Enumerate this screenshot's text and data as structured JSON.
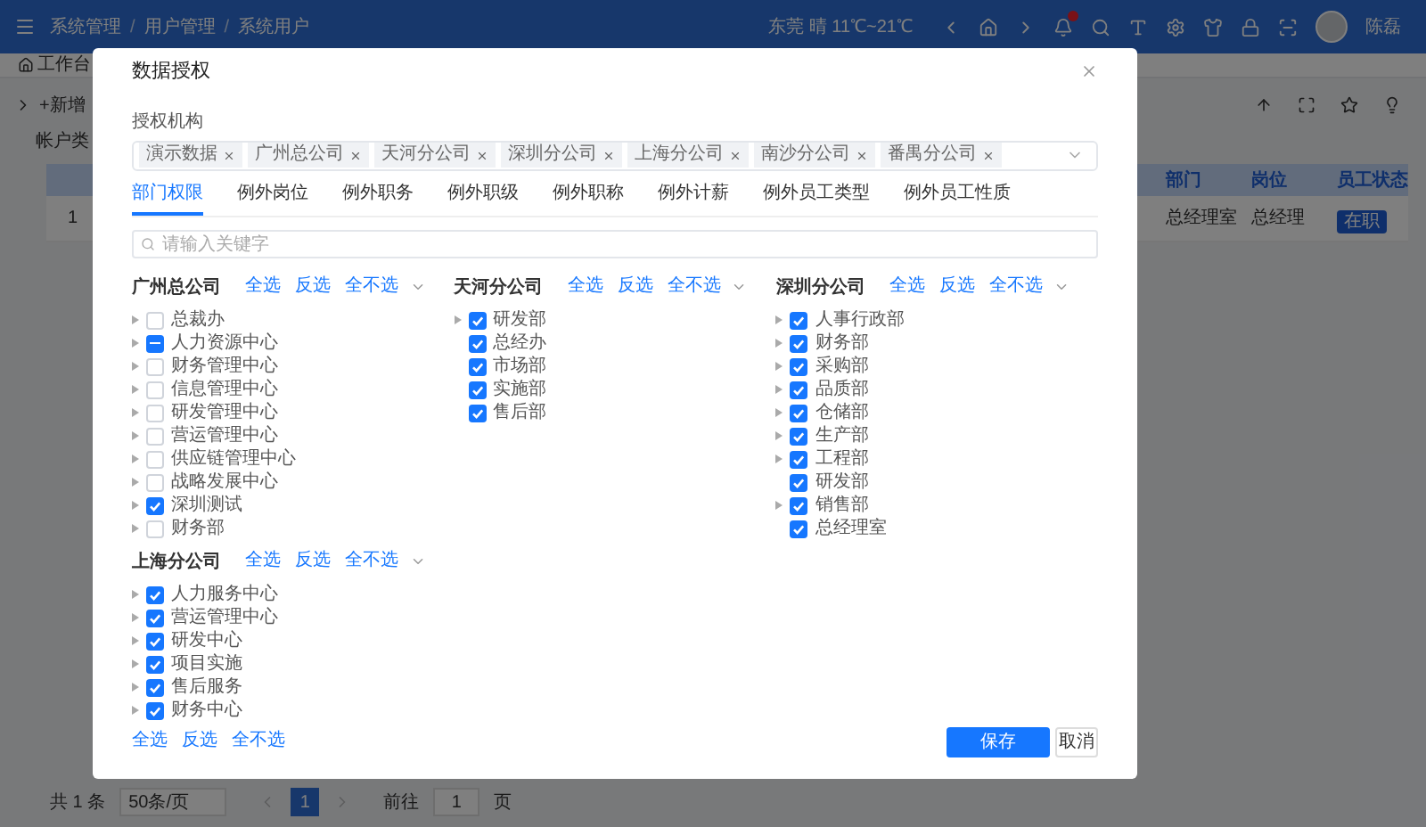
{
  "topbar": {
    "breadcrumb": [
      "系统管理",
      "用户管理",
      "系统用户"
    ],
    "separator": "/",
    "weather": "东莞 晴 11℃~21℃",
    "user": "陈磊"
  },
  "tabs_bar": {
    "tabs": [
      {
        "label": "工作台",
        "selected": true
      }
    ]
  },
  "page": {
    "add_button": "+新增",
    "filter_label": "帐户类",
    "table": {
      "columns": [
        "部门",
        "岗位",
        "员工状态"
      ],
      "rows": [
        {
          "index": "1",
          "cells": [
            "总经理室",
            "总经理"
          ],
          "status": "在职"
        }
      ]
    },
    "pagination": {
      "total": "共 1 条",
      "page_size": "50条/页",
      "pages": [
        {
          "label": "1",
          "selected": true
        }
      ],
      "goto_label": "前往",
      "goto_value": "1",
      "goto_suffix": "页"
    }
  },
  "dialog": {
    "title": "数据授权",
    "org_label": "授权机构",
    "org_tags": [
      "演示数据",
      "广州总公司",
      "天河分公司",
      "深圳分公司",
      "上海分公司",
      "南沙分公司",
      "番禺分公司"
    ],
    "tabs": [
      {
        "label": "部门权限",
        "selected": true
      },
      {
        "label": "例外岗位",
        "selected": false
      },
      {
        "label": "例外职务",
        "selected": false
      },
      {
        "label": "例外职级",
        "selected": false
      },
      {
        "label": "例外职称",
        "selected": false
      },
      {
        "label": "例外计薪",
        "selected": false
      },
      {
        "label": "例外员工类型",
        "selected": false
      },
      {
        "label": "例外员工性质",
        "selected": false
      }
    ],
    "search": {
      "placeholder": "请输入关键字"
    },
    "groups": [
      {
        "name": "广州总公司",
        "actions": [
          "全选",
          "反选",
          "全不选"
        ],
        "items": [
          {
            "label": "总裁办",
            "checked": false,
            "indeterminate": false,
            "has_children": true
          },
          {
            "label": "人力资源中心",
            "checked": false,
            "indeterminate": true,
            "has_children": true
          },
          {
            "label": "财务管理中心",
            "checked": false,
            "indeterminate": false,
            "has_children": true
          },
          {
            "label": "信息管理中心",
            "checked": false,
            "indeterminate": false,
            "has_children": true
          },
          {
            "label": "研发管理中心",
            "checked": false,
            "indeterminate": false,
            "has_children": true
          },
          {
            "label": "营运管理中心",
            "checked": false,
            "indeterminate": false,
            "has_children": true
          },
          {
            "label": "供应链管理中心",
            "checked": false,
            "indeterminate": false,
            "has_children": true
          },
          {
            "label": "战略发展中心",
            "checked": false,
            "indeterminate": false,
            "has_children": true
          },
          {
            "label": "深圳测试",
            "checked": true,
            "indeterminate": false,
            "has_children": true
          },
          {
            "label": "财务部",
            "checked": false,
            "indeterminate": false,
            "has_children": true
          }
        ]
      },
      {
        "name": "天河分公司",
        "actions": [
          "全选",
          "反选",
          "全不选"
        ],
        "items": [
          {
            "label": "研发部",
            "checked": true,
            "indeterminate": false,
            "has_children": true
          },
          {
            "label": "总经办",
            "checked": true,
            "indeterminate": false,
            "has_children": false
          },
          {
            "label": "市场部",
            "checked": true,
            "indeterminate": false,
            "has_children": false
          },
          {
            "label": "实施部",
            "checked": true,
            "indeterminate": false,
            "has_children": false
          },
          {
            "label": "售后部",
            "checked": true,
            "indeterminate": false,
            "has_children": false
          }
        ]
      },
      {
        "name": "深圳分公司",
        "actions": [
          "全选",
          "反选",
          "全不选"
        ],
        "items": [
          {
            "label": "人事行政部",
            "checked": true,
            "indeterminate": false,
            "has_children": true
          },
          {
            "label": "财务部",
            "checked": true,
            "indeterminate": false,
            "has_children": true
          },
          {
            "label": "采购部",
            "checked": true,
            "indeterminate": false,
            "has_children": true
          },
          {
            "label": "品质部",
            "checked": true,
            "indeterminate": false,
            "has_children": true
          },
          {
            "label": "仓储部",
            "checked": true,
            "indeterminate": false,
            "has_children": true
          },
          {
            "label": "生产部",
            "checked": true,
            "indeterminate": false,
            "has_children": true
          },
          {
            "label": "工程部",
            "checked": true,
            "indeterminate": false,
            "has_children": true
          },
          {
            "label": "研发部",
            "checked": true,
            "indeterminate": false,
            "has_children": false
          },
          {
            "label": "销售部",
            "checked": true,
            "indeterminate": false,
            "has_children": true
          },
          {
            "label": "总经理室",
            "checked": true,
            "indeterminate": false,
            "has_children": false
          }
        ]
      },
      {
        "name": "上海分公司",
        "actions": [
          "全选",
          "反选",
          "全不选"
        ],
        "items": [
          {
            "label": "人力服务中心",
            "checked": true,
            "indeterminate": false,
            "has_children": true
          },
          {
            "label": "营运管理中心",
            "checked": true,
            "indeterminate": false,
            "has_children": true
          },
          {
            "label": "研发中心",
            "checked": true,
            "indeterminate": false,
            "has_children": true
          },
          {
            "label": "项目实施",
            "checked": true,
            "indeterminate": false,
            "has_children": true
          },
          {
            "label": "售后服务",
            "checked": true,
            "indeterminate": false,
            "has_children": true
          },
          {
            "label": "财务中心",
            "checked": true,
            "indeterminate": false,
            "has_children": true
          }
        ]
      }
    ],
    "footer_actions": [
      "全选",
      "反选",
      "全不选"
    ],
    "save": "保存",
    "cancel": "取消"
  }
}
